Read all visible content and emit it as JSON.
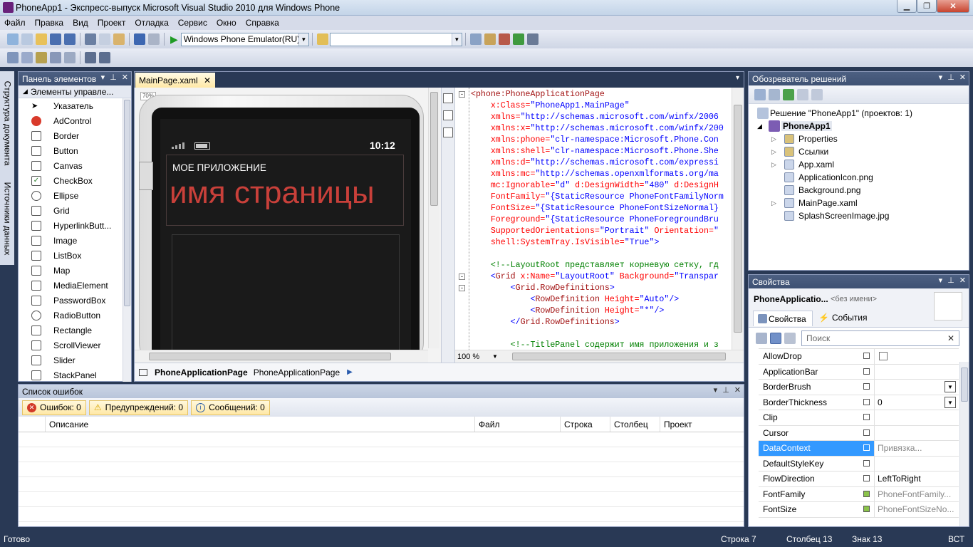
{
  "window": {
    "title": "PhoneApp1 - Экспресс-выпуск Microsoft Visual Studio 2010 для Windows Phone"
  },
  "menu": [
    "Файл",
    "Правка",
    "Вид",
    "Проект",
    "Отладка",
    "Сервис",
    "Окно",
    "Справка"
  ],
  "toolbar": {
    "target_device": "Windows Phone Emulator(RU)",
    "search_combo": ""
  },
  "sidebar_tabs": [
    "Структура документа",
    "Источники данных"
  ],
  "toolbox": {
    "title": "Панель элементов",
    "group": "Элементы управле...",
    "items": [
      "Указатель",
      "AdControl",
      "Border",
      "Button",
      "Canvas",
      "CheckBox",
      "Ellipse",
      "Grid",
      "HyperlinkButt...",
      "Image",
      "ListBox",
      "Map",
      "MediaElement",
      "PasswordBox",
      "RadioButton",
      "Rectangle",
      "ScrollViewer",
      "Slider",
      "StackPanel"
    ]
  },
  "editor": {
    "tab": "MainPage.xaml",
    "zoom_badge": "70%",
    "phone": {
      "time": "10:12",
      "app_title": "МОЕ ПРИЛОЖЕНИЕ",
      "page_title": "имя страницы"
    },
    "code_zoom": "100 %",
    "breadcrumb": {
      "bold": "PhoneApplicationPage",
      "normal": "PhoneApplicationPage"
    },
    "code_lines": [
      [
        [
          "k",
          "<phone:PhoneApplicationPage"
        ]
      ],
      [
        [
          "a",
          "    x:Class="
        ],
        [
          "v",
          "\"PhoneApp1.MainPage\""
        ]
      ],
      [
        [
          "a",
          "    xmlns="
        ],
        [
          "v",
          "\"http://schemas.microsoft.com/winfx/2006"
        ]
      ],
      [
        [
          "a",
          "    xmlns:x="
        ],
        [
          "v",
          "\"http://schemas.microsoft.com/winfx/200"
        ]
      ],
      [
        [
          "a",
          "    xmlns:phone="
        ],
        [
          "v",
          "\"clr-namespace:Microsoft.Phone.Con"
        ]
      ],
      [
        [
          "a",
          "    xmlns:shell="
        ],
        [
          "v",
          "\"clr-namespace:Microsoft.Phone.She"
        ]
      ],
      [
        [
          "a",
          "    xmlns:d="
        ],
        [
          "v",
          "\"http://schemas.microsoft.com/expressi"
        ]
      ],
      [
        [
          "a",
          "    xmlns:mc="
        ],
        [
          "v",
          "\"http://schemas.openxmlformats.org/ma"
        ]
      ],
      [
        [
          "a",
          "    mc:Ignorable="
        ],
        [
          "v",
          "\"d\""
        ],
        [
          "a",
          " d:DesignWidth="
        ],
        [
          "v",
          "\"480\""
        ],
        [
          "a",
          " d:DesignH"
        ]
      ],
      [
        [
          "a",
          "    FontFamily="
        ],
        [
          "v",
          "\"{StaticResource PhoneFontFamilyNorm"
        ]
      ],
      [
        [
          "a",
          "    FontSize="
        ],
        [
          "v",
          "\"{StaticResource PhoneFontSizeNormal}"
        ]
      ],
      [
        [
          "a",
          "    Foreground="
        ],
        [
          "v",
          "\"{StaticResource PhoneForegroundBru"
        ]
      ],
      [
        [
          "a",
          "    SupportedOrientations="
        ],
        [
          "v",
          "\"Portrait\""
        ],
        [
          "a",
          " Orientation="
        ],
        [
          "v",
          "\""
        ]
      ],
      [
        [
          "a",
          "    shell:SystemTray.IsVisible="
        ],
        [
          "v",
          "\"True\""
        ],
        [
          "b",
          ">"
        ]
      ],
      [
        [
          "k",
          ""
        ]
      ],
      [
        [
          "c",
          "    <!--LayoutRoot представляет корневую сетку, гд"
        ]
      ],
      [
        [
          "b",
          "    <"
        ],
        [
          "k",
          "Grid"
        ],
        [
          "a",
          " x:Name="
        ],
        [
          "v",
          "\"LayoutRoot\""
        ],
        [
          "a",
          " Background="
        ],
        [
          "v",
          "\"Transpar"
        ]
      ],
      [
        [
          "b",
          "        <"
        ],
        [
          "k",
          "Grid.RowDefinitions"
        ],
        [
          "b",
          ">"
        ]
      ],
      [
        [
          "b",
          "            <"
        ],
        [
          "k",
          "RowDefinition"
        ],
        [
          "a",
          " Height="
        ],
        [
          "v",
          "\"Auto\""
        ],
        [
          "b",
          "/>"
        ]
      ],
      [
        [
          "b",
          "            <"
        ],
        [
          "k",
          "RowDefinition"
        ],
        [
          "a",
          " Height="
        ],
        [
          "v",
          "\"*\""
        ],
        [
          "b",
          "/>"
        ]
      ],
      [
        [
          "b",
          "        </"
        ],
        [
          "k",
          "Grid.RowDefinitions"
        ],
        [
          "b",
          ">"
        ]
      ],
      [
        [
          "k",
          ""
        ]
      ],
      [
        [
          "c",
          "        <!--TitlePanel содержит имя приложения и з"
        ]
      ]
    ]
  },
  "solution": {
    "title": "Обозреватель решений",
    "solution_label": "Решение \"PhoneApp1\"  (проектов: 1)",
    "project": "PhoneApp1",
    "items": [
      "Properties",
      "Ссылки",
      "App.xaml",
      "ApplicationIcon.png",
      "Background.png",
      "MainPage.xaml",
      "SplashScreenImage.jpg"
    ]
  },
  "properties": {
    "title": "Свойства",
    "object": "PhoneApplicatio...",
    "object_name": "<без имени>",
    "tab_props": "Свойства",
    "tab_events": "События",
    "search_placeholder": "Поиск",
    "rows": [
      {
        "name": "AllowDrop",
        "value": ""
      },
      {
        "name": "ApplicationBar",
        "value": ""
      },
      {
        "name": "BorderBrush",
        "value": ""
      },
      {
        "name": "BorderThickness",
        "value": "0"
      },
      {
        "name": "Clip",
        "value": ""
      },
      {
        "name": "Cursor",
        "value": ""
      },
      {
        "name": "DataContext",
        "value": "Привязка..."
      },
      {
        "name": "DefaultStyleKey",
        "value": ""
      },
      {
        "name": "FlowDirection",
        "value": "LeftToRight"
      },
      {
        "name": "FontFamily",
        "value": "PhoneFontFamily..."
      },
      {
        "name": "FontSize",
        "value": "PhoneFontSizeNo..."
      }
    ]
  },
  "errors": {
    "title": "Список ошибок",
    "errors_btn": "Ошибок: 0",
    "warnings_btn": "Предупреждений: 0",
    "messages_btn": "Сообщений: 0",
    "columns": [
      "Описание",
      "Файл",
      "Строка",
      "Столбец",
      "Проект"
    ]
  },
  "status": {
    "ready": "Готово",
    "line": "Строка 7",
    "col": "Столбец 13",
    "char": "Знак 13",
    "mode": "ВСТ"
  }
}
